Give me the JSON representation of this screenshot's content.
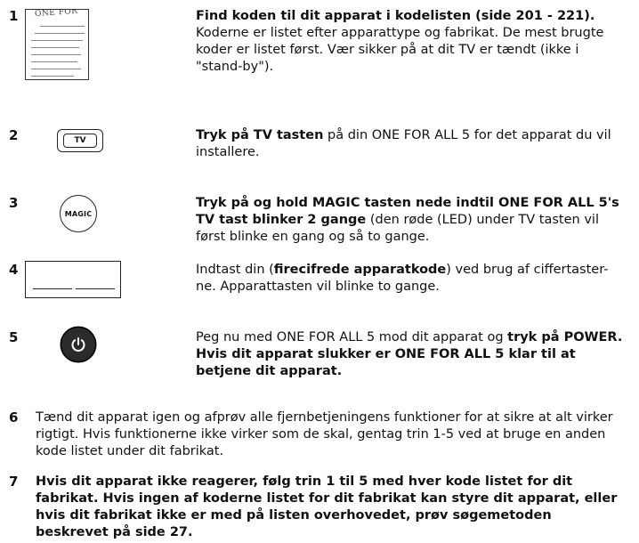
{
  "steps": [
    {
      "num": "1",
      "bold": "Find koden til dit apparat i kodelisten (side 201 - 221).",
      "text": " Koderne er listet efter apparattype og fabrikat. De mest brugte koder er listet først. Vær sikker på at dit TV er tændt (ikke i \"stand-by\").",
      "icon": "codebook-icon",
      "icon_text": "ONE FOR"
    },
    {
      "num": "2",
      "bold": "Tryk på TV tasten",
      "text": " på din ONE FOR ALL 5 for det apparat du vil installere.",
      "icon": "tv-key-icon",
      "icon_text": "TV"
    },
    {
      "num": "3",
      "bold": "Tryk på og hold MAGIC tasten nede indtil ONE FOR ALL 5's TV tast  blinker 2 gange",
      "text": " (den røde (LED) under TV tasten vil først blinke en gang og så to gange.",
      "icon": "magic-key-icon",
      "icon_text": "MAGIC"
    },
    {
      "num": "4",
      "pre": "Indtast din (",
      "bold": "firecifrede apparatkode",
      "text": ") ved brug af ciffertaster-ne. Apparattasten vil blinke to gange.",
      "icon": "code-entry-icon"
    },
    {
      "num": "5",
      "pre": "Peg nu med ONE FOR ALL 5 mod dit apparat og ",
      "bold": "tryk på POWER. Hvis dit apparat slukker er ONE FOR ALL 5 klar til at betjene dit apparat.",
      "icon": "power-key-icon"
    },
    {
      "num": "6",
      "text": "Tænd dit apparat igen og afprøv alle fjernbetjeningens funktioner for at sikre at alt virker rigtigt. Hvis funktionerne ikke virker som de skal, gentag trin 1-5 ved at bruge en anden kode listet under dit fabrikat."
    },
    {
      "num": "7",
      "bold": "Hvis dit apparat ikke reagerer, følg trin 1 til 5 med hver kode listet for dit fabrikat. Hvis ingen af koderne listet for dit fabrikat kan styre dit apparat, eller hvis dit fabrikat ikke er med på listen overhovedet, prøv søgemetoden beskrevet på side 27."
    }
  ]
}
